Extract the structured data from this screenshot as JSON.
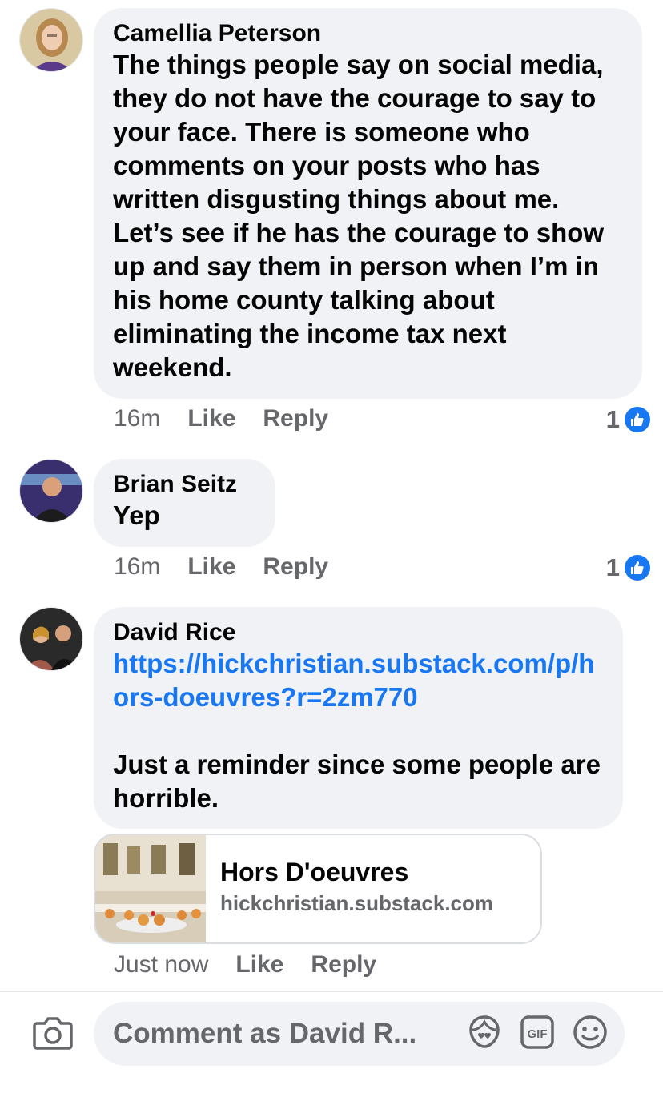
{
  "comments": [
    {
      "author": "Camellia Peterson",
      "text": "The things people say on social media, they do not have the courage to say to your face. There is someone who comments on your posts who has written disgusting things about me. Let’s see if he has the courage to show up and say them in person when I’m in his home county talking about eliminating the income tax next weekend.",
      "time": "16m",
      "like_label": "Like",
      "reply_label": "Reply",
      "reaction_count": "1"
    },
    {
      "author": "Brian Seitz",
      "text": "Yep",
      "time": "16m",
      "like_label": "Like",
      "reply_label": "Reply",
      "reaction_count": "1"
    },
    {
      "author": "David Rice",
      "link": "https://hickchristian.substack.com/p/hors-doeuvres?r=2zm770",
      "text": "Just a reminder since some people are horrible.",
      "time": "Just now",
      "like_label": "Like",
      "reply_label": "Reply",
      "preview": {
        "title": "Hors D'oeuvres",
        "domain": "hickchristian.substack.com"
      }
    }
  ],
  "composer": {
    "placeholder": "Comment as David R...",
    "icons": [
      "camera-icon",
      "avatar-sticker-icon",
      "gif-icon",
      "emoji-icon"
    ]
  },
  "colors": {
    "bubble": "#f0f2f5",
    "link": "#1877f2",
    "meta": "#65676b",
    "like_badge": "#1877f2"
  }
}
